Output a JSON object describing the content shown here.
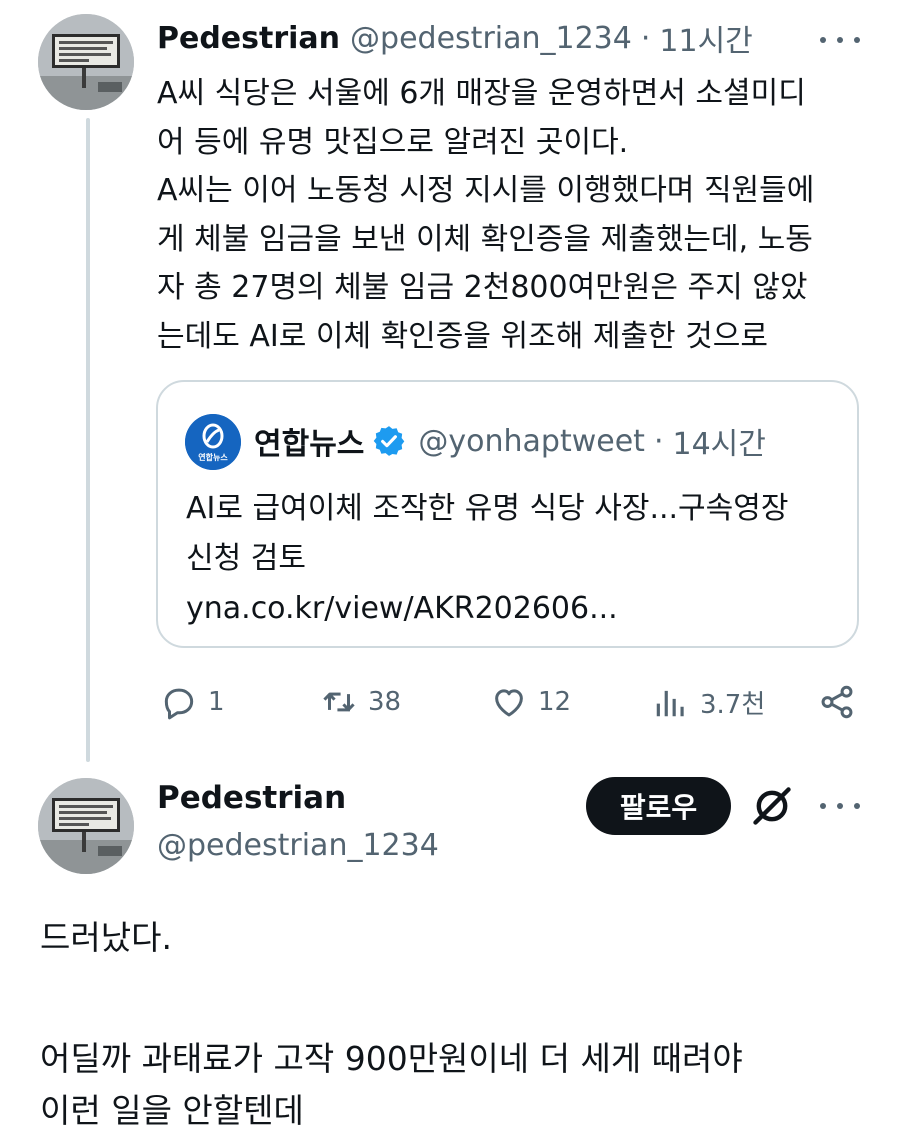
{
  "tweet1": {
    "author_name": "Pedestrian",
    "handle": "@pedestrian_1234",
    "separator": "·",
    "time": "11시간",
    "avatar_icon": "billboard-avatar",
    "lines": [
      "A씨 식당은 서울에 6개 매장을 운영하면서 소셜미디",
      "어 등에 유명 맛집으로 알려진 곳이다.",
      "A씨는 이어 노동청 시정 지시를 이행했다며 직원들에",
      "게 체불 임금을 보낸 이체 확인증을 제출했는데, 노동",
      "자 총 27명의 체불 임금 2천800여만원은 주지 않았",
      "는데도 AI로 이체 확인증을 위조해 제출한 것으로"
    ],
    "quote": {
      "author_name": "연합뉴스",
      "verified_icon": "verified-badge-icon",
      "handle": "@yonhaptweet",
      "separator": "·",
      "time": "14시간",
      "logo_text": "연합뉴스",
      "lines": [
        "AI로 급여이체 조작한 유명 식당 사장...구속영장",
        "신청 검토",
        "yna.co.kr/view/AKR202606..."
      ]
    },
    "actions": {
      "replies": "1",
      "retweets": "38",
      "likes": "12",
      "views": "3.7천"
    }
  },
  "tweet2": {
    "author_name": "Pedestrian",
    "handle": "@pedestrian_1234",
    "follow_label": "팔로우",
    "lines_block1": [
      "드러났다."
    ],
    "lines_block2": [
      "어딜까 과태료가 고작 900만원이네 더 세게 때려야",
      "이런 일을 안할텐데"
    ]
  },
  "colors": {
    "text": "#0f1419",
    "muted": "#536471",
    "border": "#cfd9de",
    "verified": "#1d9bf0",
    "yonhap_blue": "#1565c0"
  }
}
